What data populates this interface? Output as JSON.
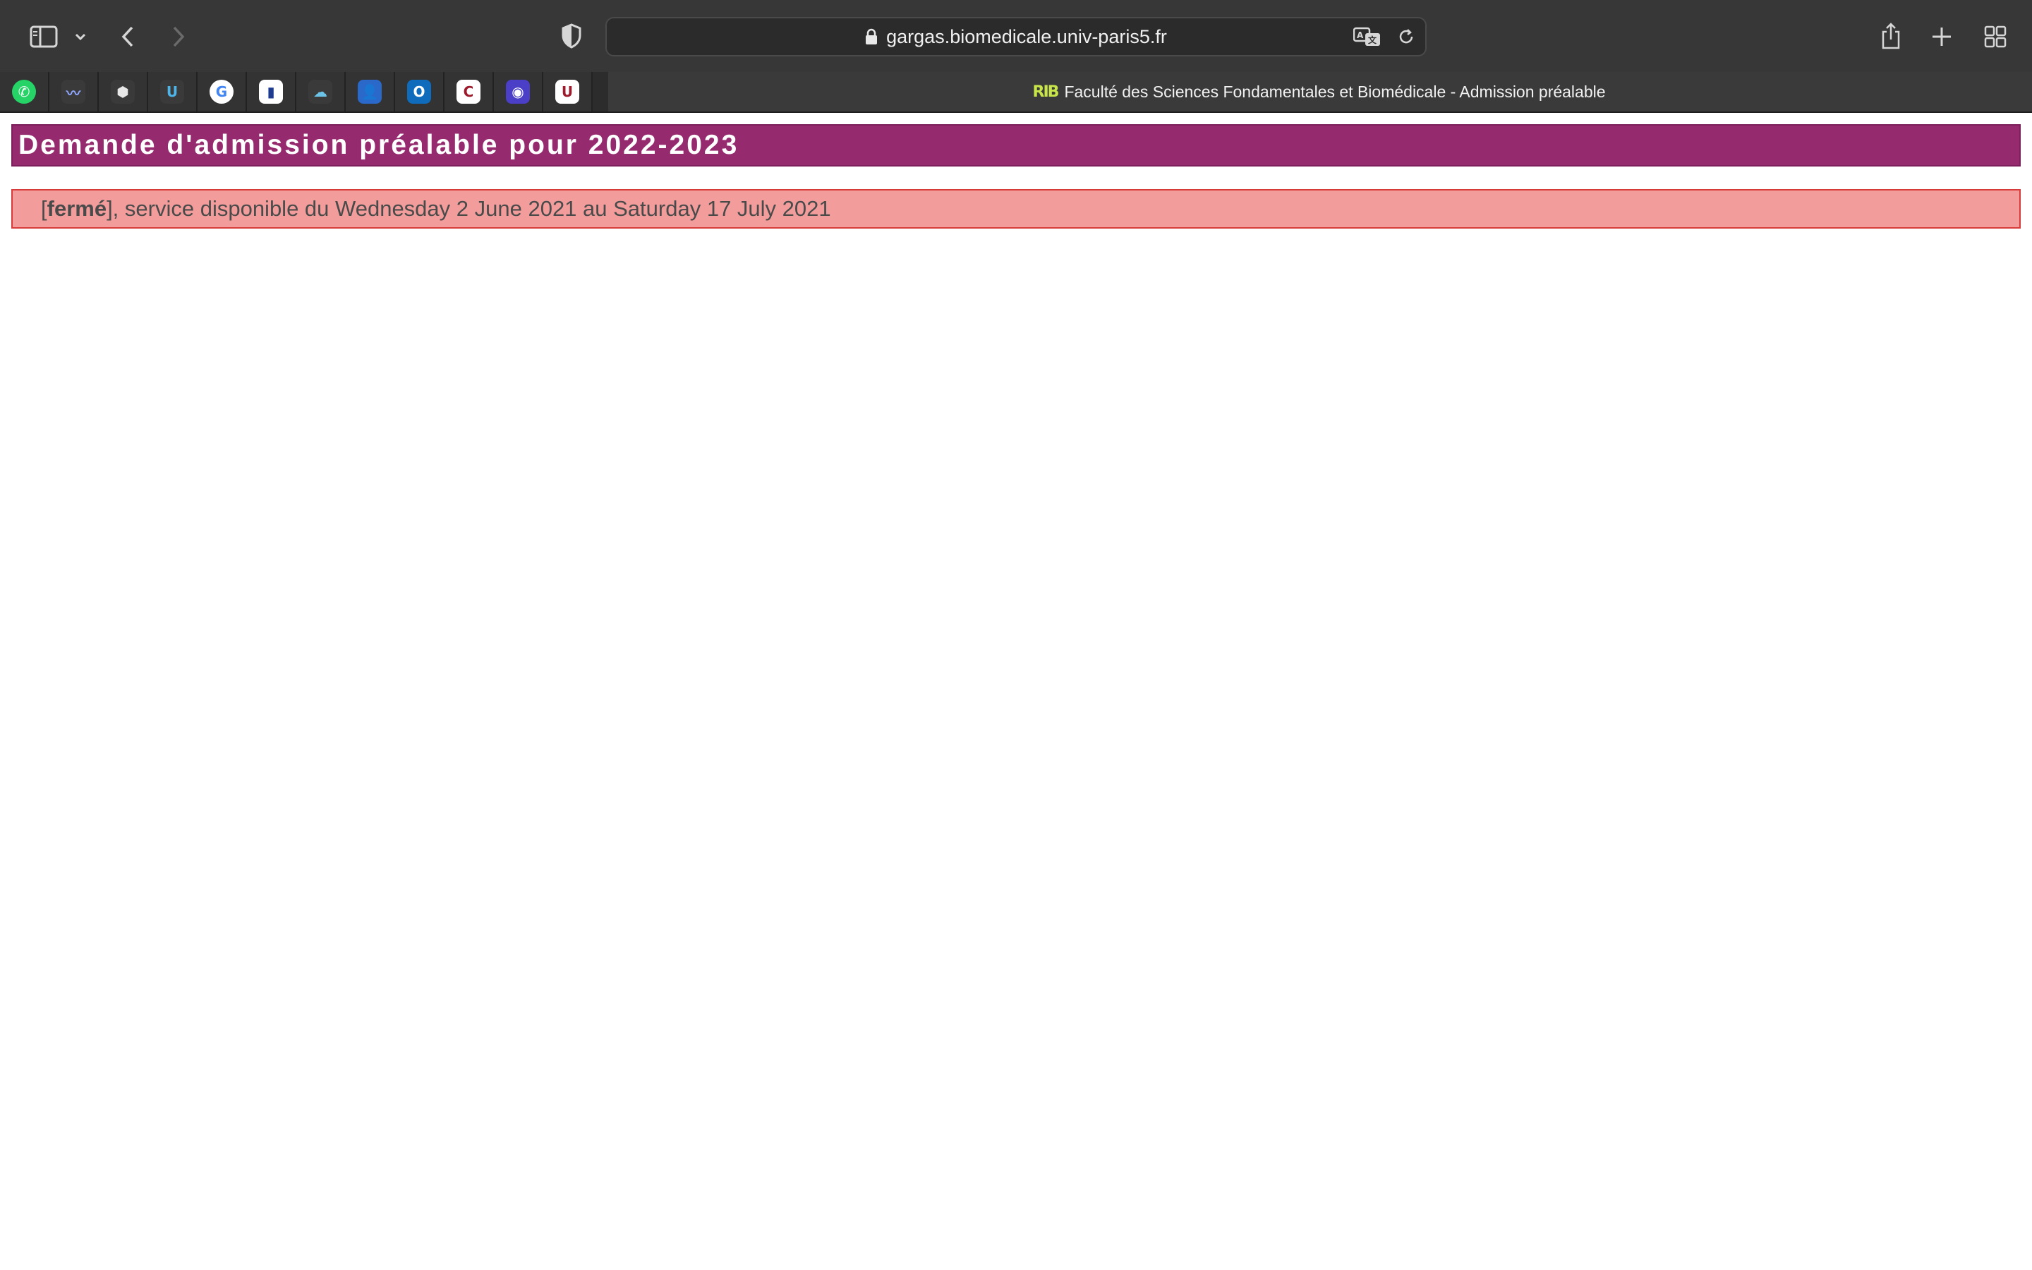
{
  "browser": {
    "url": "gargas.biomedicale.univ-paris5.fr",
    "toolbar_icons": [
      "sidebar-icon",
      "chevron-down-icon",
      "back-icon",
      "forward-icon",
      "shield-icon",
      "translate-icon",
      "reload-icon",
      "share-icon",
      "plus-icon",
      "tab-overview-icon"
    ],
    "favorites": [
      {
        "name": "whatsapp",
        "icon": "whatsapp-icon",
        "color": "#25d366",
        "glyph": "✆"
      },
      {
        "name": "sketch-line",
        "icon": "wave-icon",
        "color": "#3a3a3a",
        "glyph": "〰"
      },
      {
        "name": "polygon",
        "icon": "hexagon-icon",
        "color": "#3a3a3a",
        "glyph": "⬢"
      },
      {
        "name": "u-logo",
        "icon": "u-logo-icon",
        "color": "#3a3a3a",
        "glyph": "U"
      },
      {
        "name": "google",
        "icon": "google-icon",
        "color": "#ffffff",
        "glyph": "G"
      },
      {
        "name": "france",
        "icon": "flag-icon",
        "color": "#ffffff",
        "glyph": "▮"
      },
      {
        "name": "cloud",
        "icon": "cloud-icon",
        "color": "#3a3a3a",
        "glyph": "☁"
      },
      {
        "name": "contacts",
        "icon": "person-icon",
        "color": "#2a68c9",
        "glyph": "👤"
      },
      {
        "name": "outlook",
        "icon": "outlook-icon",
        "color": "#0f6cbd",
        "glyph": "O"
      },
      {
        "name": "c-logo",
        "icon": "c-logo-icon",
        "color": "#ffffff",
        "glyph": "C"
      },
      {
        "name": "blue-circle",
        "icon": "circle-icon",
        "color": "#4b3fc7",
        "glyph": "◉"
      },
      {
        "name": "university",
        "icon": "university-icon",
        "color": "#ffffff",
        "glyph": "U"
      }
    ],
    "active_tab": {
      "favicon": "RIB",
      "title": "Faculté des Sciences Fondamentales et Biomédicale - Admission préalable"
    }
  },
  "page": {
    "title": "Demande d'admission préalable pour 2022-2023",
    "notice": {
      "open_bracket": "[",
      "status": "fermé",
      "rest": "], service disponible du Wednesday 2 June 2021 au Saturday 17 July 2021"
    },
    "colors": {
      "banner": "#962a6f",
      "notice_bg": "#f29d9b",
      "notice_border": "#d93a3a"
    }
  }
}
